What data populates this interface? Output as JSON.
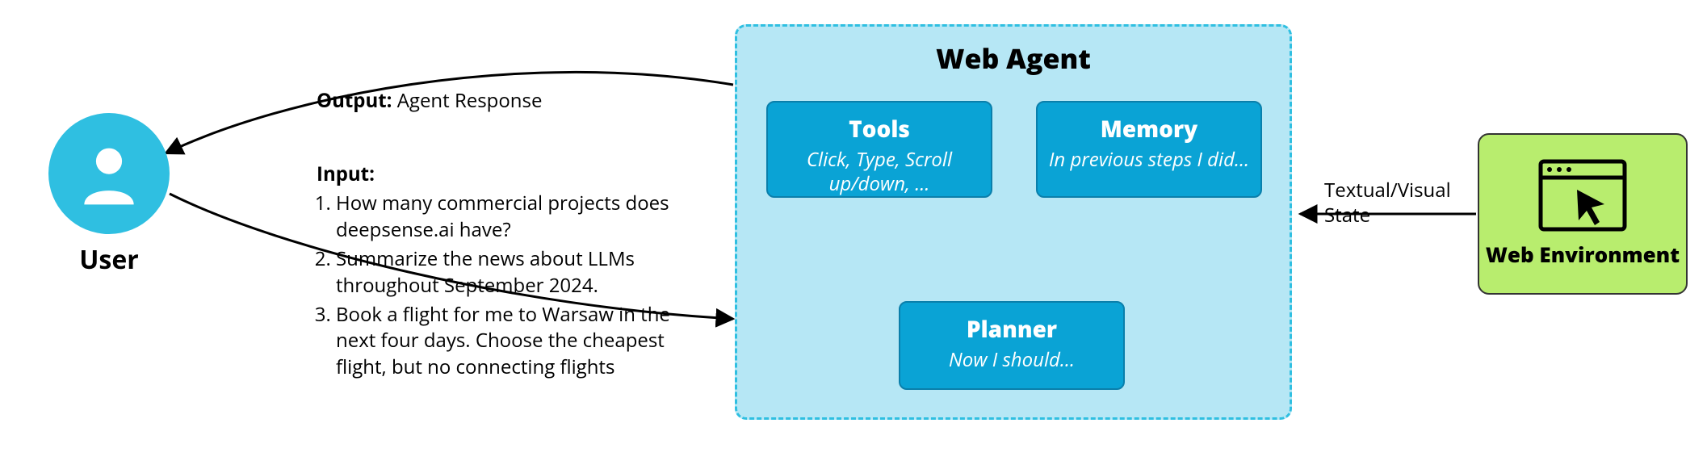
{
  "user": {
    "label": "User"
  },
  "io": {
    "output_bold": "Output:",
    "output_text": " Agent Response",
    "input_bold": "Input:",
    "input_items": [
      "How many commercial projects does deepsense.ai have?",
      "Summarize the news about LLMs throughout September 2024.",
      "Book a flight for me to Warsaw in the next four days. Choose the cheapest flight, but no connecting flights"
    ]
  },
  "agent": {
    "title": "Web Agent",
    "modules": {
      "tools": {
        "title": "Tools",
        "desc": "Click, Type, Scroll up/down, …"
      },
      "memory": {
        "title": "Memory",
        "desc": "In previous steps I did…"
      },
      "planner": {
        "title": "Planner",
        "desc": "Now I should…"
      }
    }
  },
  "env": {
    "label": "Web Environment",
    "state_label": "Textual/Visual State"
  },
  "colors": {
    "agent_bg": "#b6e7f5",
    "agent_border": "#2fbfe1",
    "module_bg": "#0aa3d5",
    "module_border": "#0a7fab",
    "env_bg": "#b8ed6e",
    "avatar_bg": "#2fbfe1"
  }
}
